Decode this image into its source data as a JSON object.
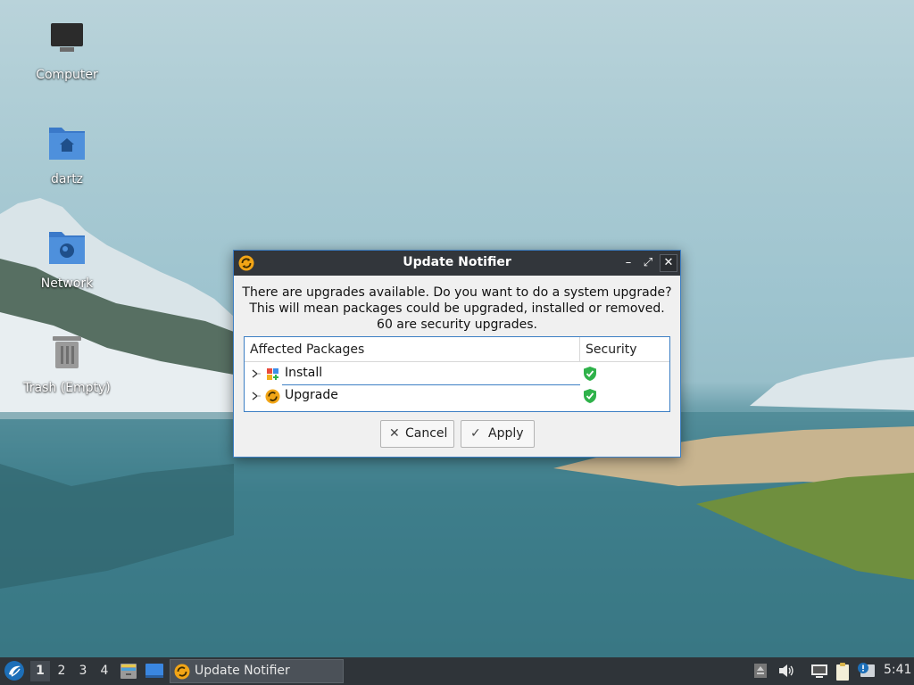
{
  "desktop": {
    "icons": [
      {
        "label": "Computer"
      },
      {
        "label": "dartz"
      },
      {
        "label": "Network"
      },
      {
        "label": "Trash (Empty)"
      }
    ]
  },
  "dialog": {
    "title": "Update Notifier",
    "message_lines": [
      "There are upgrades available. Do you want to do a system upgrade?",
      "This will mean packages could be upgraded, installed or removed.",
      "60 are security upgrades."
    ],
    "table": {
      "columns": [
        "Affected Packages",
        "Security"
      ],
      "rows": [
        {
          "label": "Install",
          "security_icon": "green-shield-check-icon"
        },
        {
          "label": "Upgrade",
          "security_icon": "green-shield-check-icon"
        }
      ]
    },
    "buttons": {
      "cancel": {
        "label": "Cancel",
        "icon": "x-icon"
      },
      "apply": {
        "label": "Apply",
        "icon": "checkmark-icon"
      }
    },
    "window_controls": {
      "minimize": "–",
      "maximize": "⤢",
      "close": "✕"
    }
  },
  "taskbar": {
    "workspaces": [
      "1",
      "2",
      "3",
      "4"
    ],
    "active_workspace": "1",
    "task": {
      "label": "Update Notifier"
    },
    "clock": "5:41"
  },
  "colors": {
    "accent": "#3d7fc4",
    "titlebar": "#32363b",
    "taskbar": "#2f3439",
    "shield_green": "#2fb24a",
    "update_icon_orange": "#f2a516"
  }
}
